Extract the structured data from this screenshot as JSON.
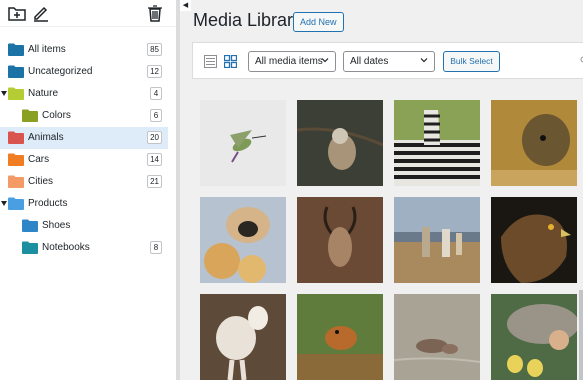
{
  "toolbar": {
    "icons": [
      "add-folder-icon",
      "edit-pencil-icon",
      "trash-icon"
    ]
  },
  "folders": [
    {
      "label": "All items",
      "count": "85",
      "color": "#1b73a5",
      "indent": 0,
      "caret": false,
      "selected": false
    },
    {
      "label": "Uncategorized",
      "count": "12",
      "color": "#1b73a5",
      "indent": 0,
      "caret": false,
      "selected": false
    },
    {
      "label": "Nature",
      "count": "4",
      "color": "#b5cc35",
      "indent": 0,
      "caret": true,
      "selected": false
    },
    {
      "label": "Colors",
      "count": "6",
      "color": "#8aa023",
      "indent": 1,
      "caret": false,
      "selected": false
    },
    {
      "label": "Animals",
      "count": "20",
      "color": "#d9534f",
      "indent": 0,
      "caret": false,
      "selected": true
    },
    {
      "label": "Cars",
      "count": "14",
      "color": "#f07c23",
      "indent": 0,
      "caret": false,
      "selected": false
    },
    {
      "label": "Cities",
      "count": "21",
      "color": "#f49a66",
      "indent": 0,
      "caret": false,
      "selected": false
    },
    {
      "label": "Products",
      "count": "",
      "color": "#4a9fe3",
      "indent": 0,
      "caret": true,
      "selected": false
    },
    {
      "label": "Shoes",
      "count": "",
      "color": "#2e86c9",
      "indent": 1,
      "caret": false,
      "selected": false
    },
    {
      "label": "Notebooks",
      "count": "8",
      "color": "#1c8fa0",
      "indent": 1,
      "caret": false,
      "selected": false
    }
  ],
  "header": {
    "title": "Media Library",
    "add_new": "Add New"
  },
  "filters": {
    "type_selected": "All media items",
    "date_selected": "All dates",
    "bulk_select": "Bulk Select",
    "active_view": "grid"
  },
  "colors": {
    "accent": "#2271b1",
    "selected_row": "#deebf8"
  },
  "media": [
    {
      "name": "hummingbird",
      "bg": "#e9e9ea",
      "fg": "#7e9a57"
    },
    {
      "name": "sparrow",
      "bg": "#3b3f36",
      "fg": "#a89478"
    },
    {
      "name": "zebra",
      "bg": "#8aa256",
      "fg": "#1e1e1e"
    },
    {
      "name": "hyena",
      "bg": "#b08a3a",
      "fg": "#6b5632"
    },
    {
      "name": "pug",
      "bg": "#b7c2d0",
      "fg": "#d6b48a"
    },
    {
      "name": "kudu",
      "bg": "#6a4a35",
      "fg": "#a88466"
    },
    {
      "name": "llamas",
      "bg": "#9fb0c3",
      "fg": "#b9a98f"
    },
    {
      "name": "eagle",
      "bg": "#1a1712",
      "fg": "#6b4b2a"
    },
    {
      "name": "goat",
      "bg": "#5e4a38",
      "fg": "#e8e2d8"
    },
    {
      "name": "puppy",
      "bg": "#5f7c3c",
      "fg": "#b76a2c"
    },
    {
      "name": "hippo",
      "bg": "#a8a394",
      "fg": "#7b6454"
    },
    {
      "name": "ducklings",
      "bg": "#4f6b45",
      "fg": "#e8d25a"
    }
  ]
}
